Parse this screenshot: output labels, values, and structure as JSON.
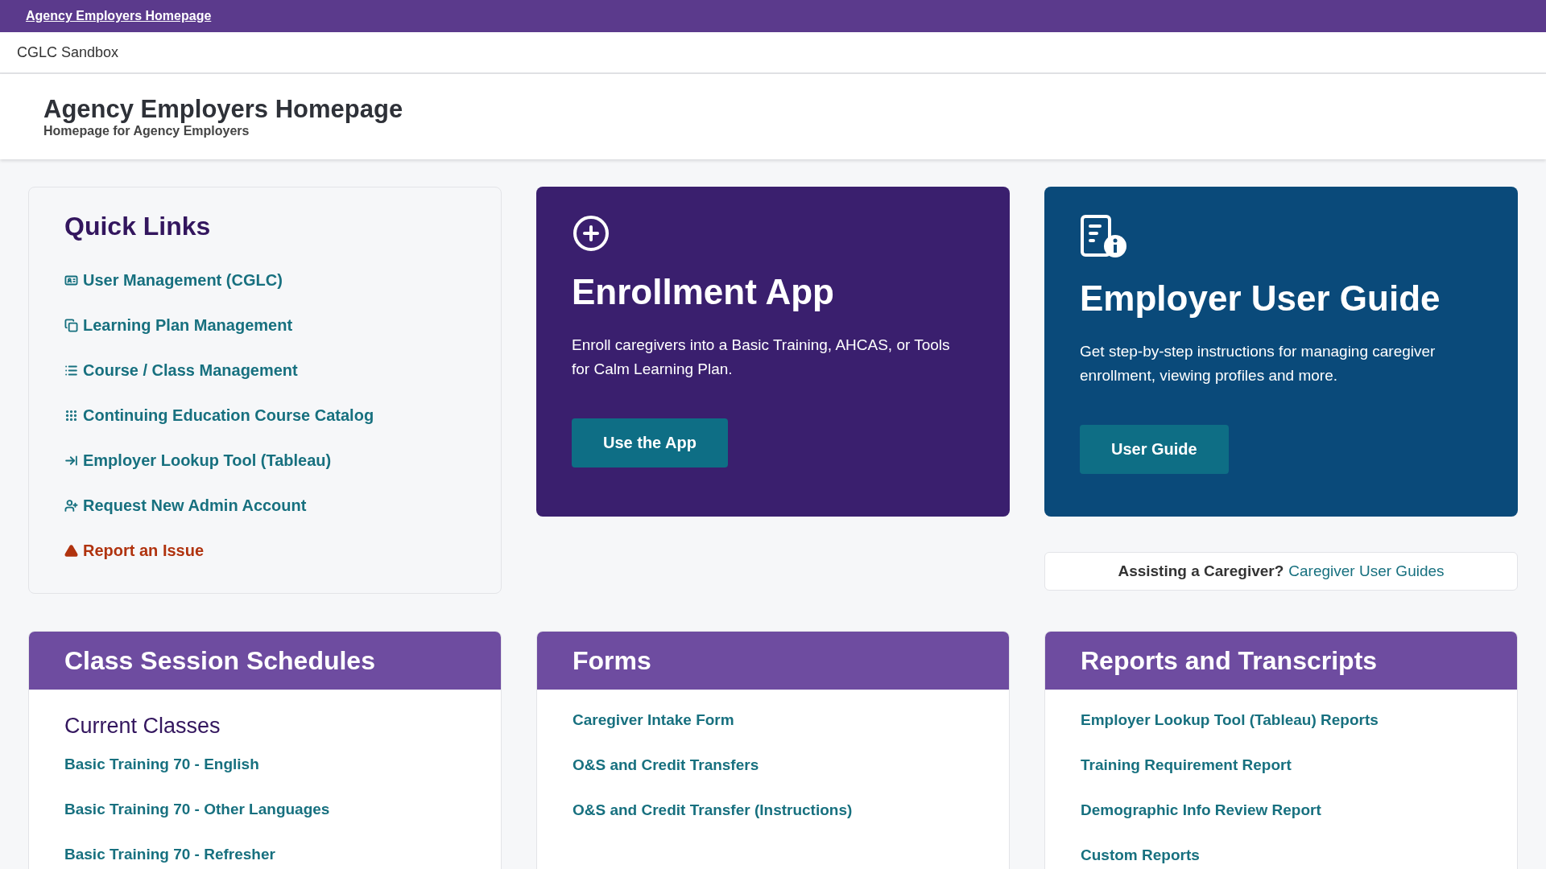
{
  "top_bar": {
    "link": "Agency Employers Homepage"
  },
  "site_bar": {
    "name": "CGLC Sandbox"
  },
  "header": {
    "title": "Agency Employers Homepage",
    "subtitle": "Homepage for Agency Employers"
  },
  "quick_links": {
    "title": "Quick Links",
    "items": [
      {
        "label": "User Management (CGLC)",
        "kind": "id-card"
      },
      {
        "label": "Learning Plan Management",
        "kind": "books"
      },
      {
        "label": "Course / Class Management",
        "kind": "list"
      },
      {
        "label": "Continuing Education Course Catalog",
        "kind": "grid"
      },
      {
        "label": "Employer Lookup Tool (Tableau)",
        "kind": "arrow-in"
      },
      {
        "label": "Request New Admin Account",
        "kind": "user-plus"
      },
      {
        "label": "Report an Issue",
        "kind": "warning"
      }
    ]
  },
  "feature_cards": [
    {
      "kind": "enroll",
      "title": "Enrollment App",
      "description": "Enroll caregivers into a Basic Training, AHCAS, or Tools for Calm Learning Plan.",
      "button": "Use the App"
    },
    {
      "kind": "guide",
      "title": "Employer User Guide",
      "description": "Get step-by-step instructions for managing caregiver enrollment, viewing profiles and more.",
      "button": "User Guide"
    }
  ],
  "assist": {
    "prompt": "Assisting a Caregiver?",
    "link": "Caregiver User Guides"
  },
  "sections": [
    {
      "title": "Class Session Schedules",
      "subtitle": "Current Classes",
      "links": [
        "Basic Training 70 - English",
        "Basic Training 70 - Other Languages",
        "Basic Training 70 - Refresher"
      ]
    },
    {
      "title": "Forms",
      "links": [
        "Caregiver Intake Form",
        "O&S and Credit Transfers",
        "O&S and Credit Transfer (Instructions)"
      ]
    },
    {
      "title": "Reports and Transcripts",
      "links": [
        "Employer Lookup Tool (Tableau) Reports",
        "Training Requirement Report",
        "Demographic Info Review Report",
        "Custom Reports"
      ]
    }
  ]
}
